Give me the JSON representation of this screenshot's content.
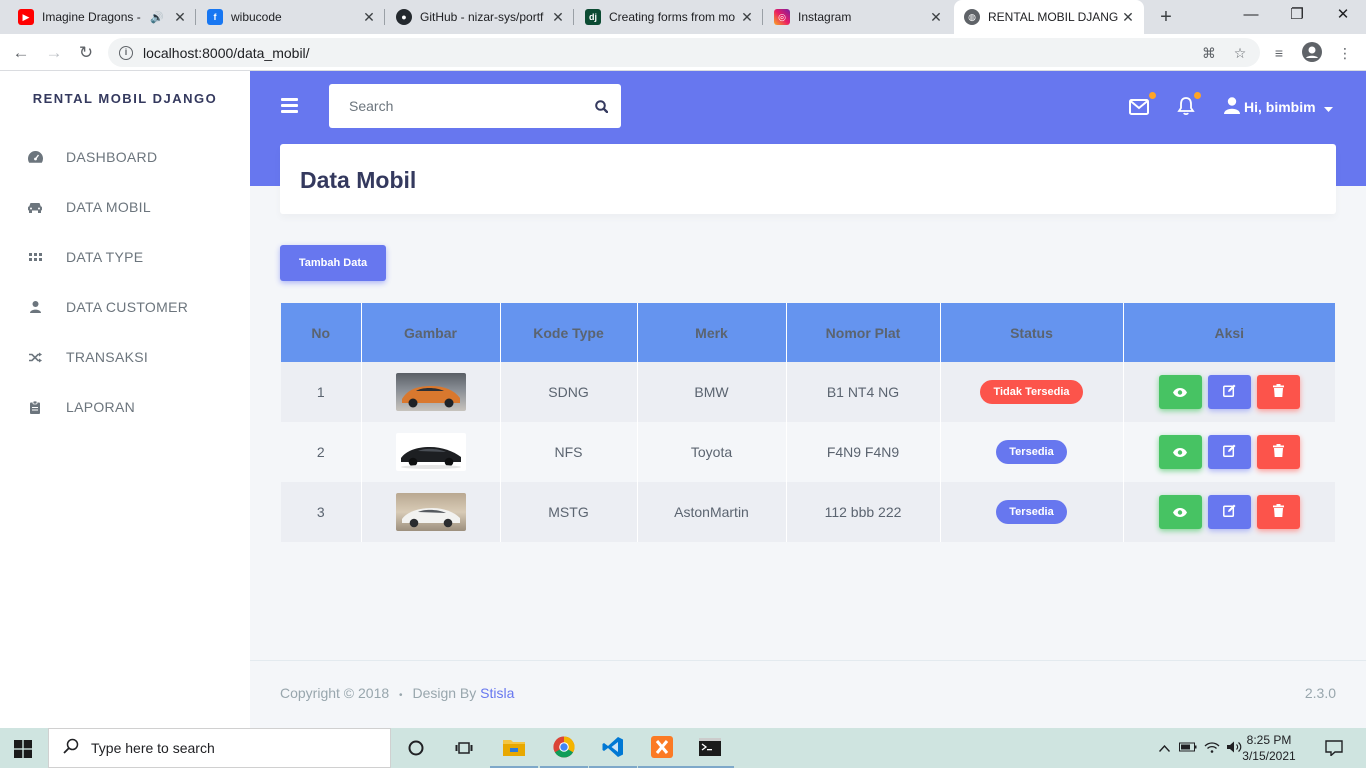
{
  "browser": {
    "tabs": [
      {
        "title": "Imagine Dragons -",
        "favicon": "youtube-icon"
      },
      {
        "title": "wibucode",
        "favicon": "facebook-icon"
      },
      {
        "title": "GitHub - nizar-sys/portf",
        "favicon": "github-icon"
      },
      {
        "title": "Creating forms from mo",
        "favicon": "django-icon"
      },
      {
        "title": "Instagram",
        "favicon": "instagram-icon"
      },
      {
        "title": "RENTAL MOBIL DJANGO",
        "favicon": "globe-icon"
      }
    ],
    "url": "localhost:8000/data_mobil/"
  },
  "sidebar": {
    "brand": "RENTAL MOBIL DJANGO",
    "items": [
      {
        "label": "DASHBOARD",
        "icon": "tachometer-icon"
      },
      {
        "label": "DATA MOBIL",
        "icon": "car-icon"
      },
      {
        "label": "DATA TYPE",
        "icon": "grid-icon"
      },
      {
        "label": "DATA CUSTOMER",
        "icon": "user-icon"
      },
      {
        "label": "TRANSAKSI",
        "icon": "shuffle-icon"
      },
      {
        "label": "LAPORAN",
        "icon": "clipboard-icon"
      }
    ]
  },
  "header": {
    "search_placeholder": "Search",
    "user_greeting": "Hi, bimbim"
  },
  "page": {
    "title": "Data Mobil",
    "add_button": "Tambah Data"
  },
  "table": {
    "headers": [
      "No",
      "Gambar",
      "Kode Type",
      "Merk",
      "Nomor Plat",
      "Status",
      "Aksi"
    ],
    "rows": [
      {
        "no": "1",
        "kode_type": "SDNG",
        "merk": "BMW",
        "nomor_plat": "B1 NT4 NG",
        "status": "Tidak Tersedia",
        "status_color": "#fc544b"
      },
      {
        "no": "2",
        "kode_type": "NFS",
        "merk": "Toyota",
        "nomor_plat": "F4N9 F4N9",
        "status": "Tersedia",
        "status_color": "#6777ef"
      },
      {
        "no": "3",
        "kode_type": "MSTG",
        "merk": "AstonMartin",
        "nomor_plat": "112 bbb 222",
        "status": "Tersedia",
        "status_color": "#6777ef"
      }
    ]
  },
  "footer": {
    "copyright": "Copyright © 2018",
    "bullet": "•",
    "design_by": "Design By",
    "link": "Stisla",
    "version": "2.3.0"
  },
  "taskbar": {
    "search_placeholder": "Type here to search",
    "time": "8:25 PM",
    "date": "3/15/2021"
  },
  "colors": {
    "primary": "#6777ef",
    "success": "#47c363",
    "danger": "#fc544b",
    "table_header": "#6594ef"
  }
}
